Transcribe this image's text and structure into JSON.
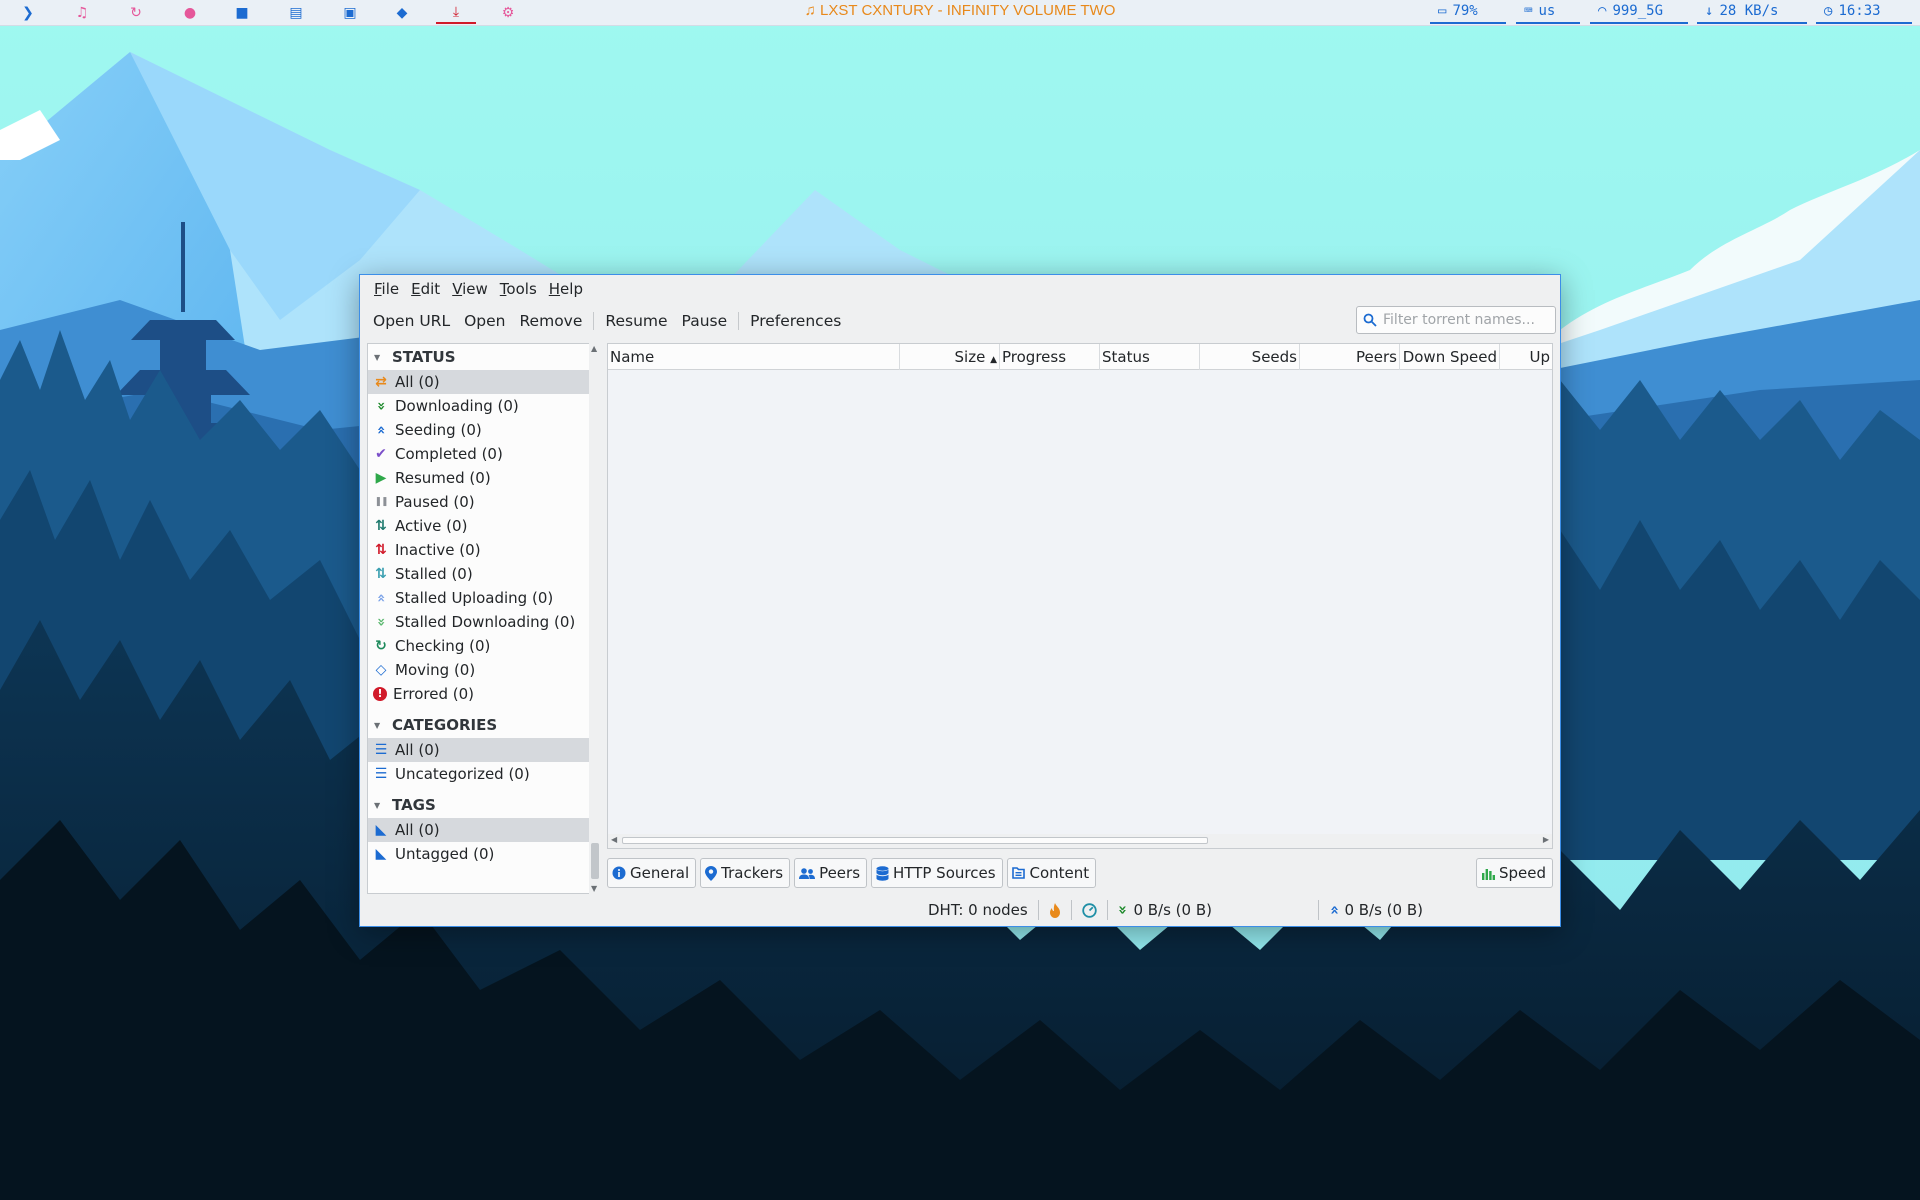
{
  "topbar": {
    "launchers": [
      {
        "icon": "terminal-icon",
        "glyph": "❯",
        "color": "#1c6bd1"
      },
      {
        "icon": "music-icon",
        "glyph": "♫",
        "color": "#e5579a"
      },
      {
        "icon": "refresh-icon",
        "glyph": "↻",
        "color": "#e5579a"
      },
      {
        "icon": "chat-icon",
        "glyph": "●",
        "color": "#e5579a"
      },
      {
        "icon": "video-icon",
        "glyph": "■",
        "color": "#1c6bd1"
      },
      {
        "icon": "folder-icon",
        "glyph": "▤",
        "color": "#1c6bd1"
      },
      {
        "icon": "image-icon",
        "glyph": "▣",
        "color": "#1c6bd1"
      },
      {
        "icon": "cube-icon",
        "glyph": "◆",
        "color": "#1c6bd1"
      },
      {
        "icon": "download-icon",
        "glyph": "⤓",
        "color": "#d11a2a"
      },
      {
        "icon": "settings-icon",
        "glyph": "⚙",
        "color": "#e5579a"
      }
    ],
    "now_playing": "♫ LXST CXNTURY - INFINITY VOLUME TWO",
    "battery": {
      "icon": "▭",
      "value": "79%"
    },
    "keyboard": {
      "icon": "⌨",
      "value": "us"
    },
    "wifi": {
      "icon": "◠",
      "value": "999_5G"
    },
    "net": {
      "icon": "↓",
      "value": "28 KB/s"
    },
    "clock": {
      "icon": "◷",
      "value": "16:33"
    }
  },
  "window": {
    "menus": [
      {
        "underline": "F",
        "rest": "ile"
      },
      {
        "underline": "E",
        "rest": "dit"
      },
      {
        "underline": "V",
        "rest": "iew"
      },
      {
        "underline": "T",
        "rest": "ools"
      },
      {
        "underline": "H",
        "rest": "elp"
      }
    ],
    "toolbar": {
      "open_url": "Open URL",
      "open": "Open",
      "remove": "Remove",
      "resume": "Resume",
      "pause": "Pause",
      "preferences": "Preferences"
    },
    "filter_placeholder": "Filter torrent names...",
    "sidebar": {
      "status_title": "STATUS",
      "status": [
        {
          "label": "All (0)",
          "icon": "shuffle-icon",
          "glyph": "⇄",
          "color": "#e8891b",
          "selected": true
        },
        {
          "label": "Downloading (0)",
          "icon": "downloading-icon",
          "glyph": "»",
          "color": "#1e8a2c"
        },
        {
          "label": "Seeding (0)",
          "icon": "seeding-icon",
          "glyph": "«",
          "color": "#1c6bd1"
        },
        {
          "label": "Completed (0)",
          "icon": "check-icon",
          "glyph": "✔",
          "color": "#7b4fc9"
        },
        {
          "label": "Resumed (0)",
          "icon": "play-icon",
          "glyph": "▶",
          "color": "#2ea84a"
        },
        {
          "label": "Paused (0)",
          "icon": "pause-icon",
          "glyph": "❚❚",
          "color": "#8c9096"
        },
        {
          "label": "Active (0)",
          "icon": "active-arrows-icon",
          "glyph": "⇅",
          "color": "#1f7a6e"
        },
        {
          "label": "Inactive (0)",
          "icon": "inactive-arrows-icon",
          "glyph": "⇅",
          "color": "#d11a2a"
        },
        {
          "label": "Stalled (0)",
          "icon": "stalled-arrows-icon",
          "glyph": "⇅",
          "color": "#3a9fb0"
        },
        {
          "label": "Stalled Uploading (0)",
          "icon": "stalled-upload-icon",
          "glyph": "«",
          "color": "#7da4e8"
        },
        {
          "label": "Stalled Downloading (0)",
          "icon": "stalled-download-icon",
          "glyph": "»",
          "color": "#5cb870"
        },
        {
          "label": "Checking (0)",
          "icon": "checking-icon",
          "glyph": "↻",
          "color": "#1e8a5c"
        },
        {
          "label": "Moving (0)",
          "icon": "moving-icon",
          "glyph": "◇",
          "color": "#1c6bd1"
        },
        {
          "label": "Errored (0)",
          "icon": "error-icon",
          "glyph": "!",
          "color": "#d11a2a"
        }
      ],
      "categories_title": "CATEGORIES",
      "categories": [
        {
          "label": "All (0)",
          "icon": "list-icon",
          "glyph": "☰",
          "color": "#1c6bd1",
          "selected": true
        },
        {
          "label": "Uncategorized (0)",
          "icon": "list-icon",
          "glyph": "☰",
          "color": "#1c6bd1"
        }
      ],
      "tags_title": "TAGS",
      "tags": [
        {
          "label": "All (0)",
          "icon": "tag-icon",
          "glyph": "◣",
          "color": "#1c6bd1",
          "selected": true
        },
        {
          "label": "Untagged (0)",
          "icon": "tag-icon",
          "glyph": "◣",
          "color": "#1c6bd1"
        }
      ]
    },
    "columns": [
      "Name",
      "Size",
      "Progress",
      "Status",
      "Seeds",
      "Peers",
      "Down Speed",
      "Up"
    ],
    "tabs": {
      "general": "General",
      "trackers": "Trackers",
      "peers": "Peers",
      "http_sources": "HTTP Sources",
      "content": "Content",
      "speed": "Speed"
    },
    "statusbar": {
      "dht": "DHT: 0 nodes",
      "download": "0 B/s (0 B)",
      "upload": "0 B/s (0 B)"
    }
  }
}
